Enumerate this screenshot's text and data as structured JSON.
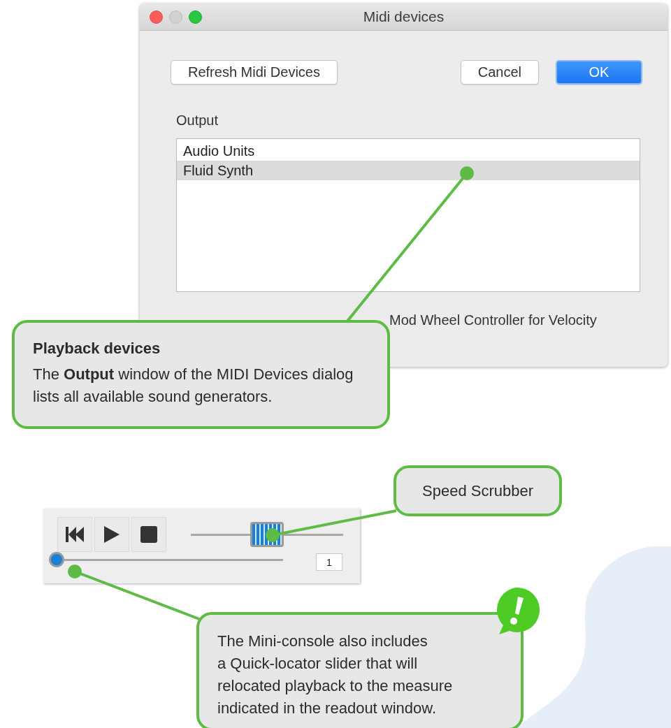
{
  "dialog": {
    "title": "Midi devices",
    "buttons": [
      {
        "label": "Refresh Midi Devices",
        "kind": "plain"
      },
      {
        "label": "Cancel",
        "kind": "plain"
      },
      {
        "label": "OK",
        "kind": "default"
      }
    ],
    "output_label": "Output",
    "output_list": [
      {
        "label": "Audio Units",
        "selected": false
      },
      {
        "label": "Fluid Synth",
        "selected": true
      }
    ],
    "checkbox_label": "Mod Wheel Controller for Velocity"
  },
  "callout_playback": {
    "title": "Playback devices",
    "text": "The **Output** window of the MIDI Devices dialog lists all available sound generators."
  },
  "mini_console": {
    "speed_scrubber": {
      "level": 0.5
    },
    "quick_locator": {
      "level": 0
    },
    "readout": "1"
  },
  "callout_speed": {
    "text": "Speed Scrubber"
  },
  "callout_note": {
    "text": "The Mini-console also includes\na Quick-locator slider that will\nrelocated playback to the measure\nindicated in the readout window."
  }
}
